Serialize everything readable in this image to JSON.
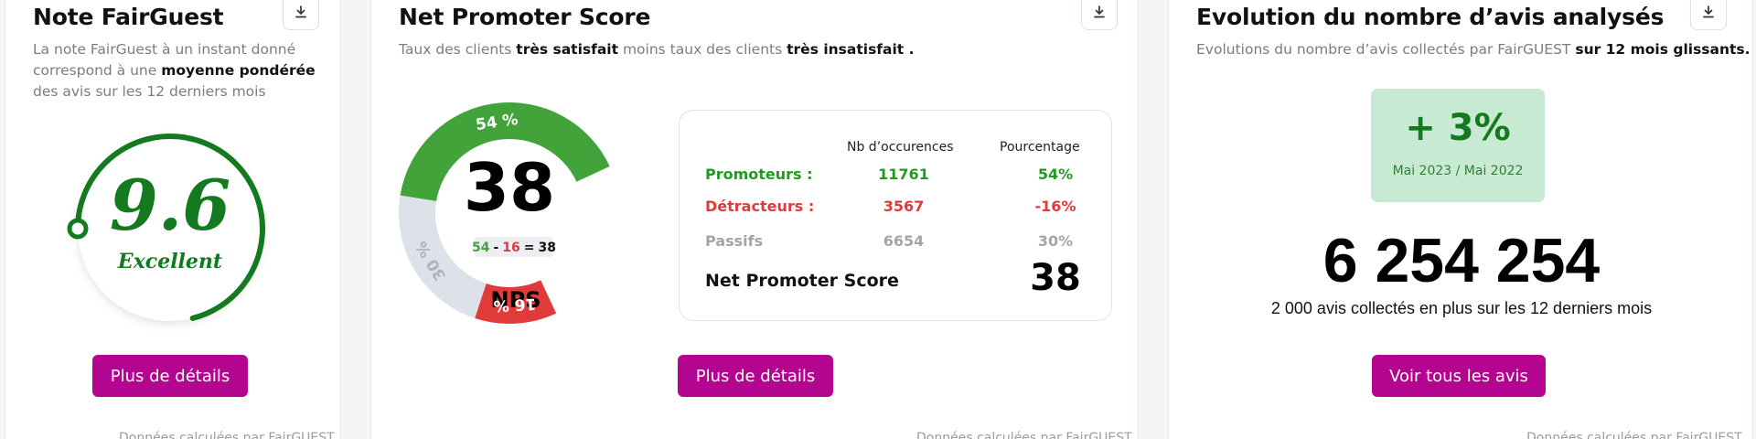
{
  "colors": {
    "brand": "#b3058f",
    "green": "#41a33a",
    "dark_green": "#137a1f",
    "red": "#e03a3a",
    "grey": "#a2a5aa",
    "light_grey": "#dde2ea"
  },
  "card1": {
    "title": "Note FairGuest",
    "desc_part1": "La note FairGuest à un instant donné correspond à une ",
    "desc_bold": "moyenne pondérée",
    "desc_part2": " des avis sur les 12 derniers mois",
    "score": "9.6",
    "score_label": "Excellent",
    "score_fraction": 0.96,
    "button": "Plus de détails",
    "footnote": "Données calculées par FairGUEST",
    "download_icon": "download-icon"
  },
  "card2": {
    "title": "Net Promoter Score",
    "desc_part1": "Taux des clients ",
    "desc_bold1": "très satisfait",
    "desc_part2": " moins taux des clients ",
    "desc_bold2": "très insatisfait .",
    "gauge": {
      "center_value": "38",
      "formula_a": "54",
      "formula_minus": "-",
      "formula_b": "16",
      "formula_eq": "=",
      "formula_result": "38",
      "label": "NPS",
      "segments": [
        {
          "name": "promoteurs",
          "percent": 54,
          "label": "54 %"
        },
        {
          "name": "detracteurs",
          "percent": 16,
          "label": "16 %"
        },
        {
          "name": "passifs",
          "percent": 30,
          "label": "30 %"
        }
      ]
    },
    "table": {
      "col_occurrences": "Nb d’occurences",
      "col_percent": "Pourcentage",
      "rows": [
        {
          "label": "Promoteurs :",
          "count": "11761",
          "percent": "54%"
        },
        {
          "label": "Détracteurs :",
          "count": "3567",
          "percent": "-16%"
        },
        {
          "label": "Passifs",
          "count": "6654",
          "percent": "30%"
        }
      ],
      "nps_label": "Net Promoter Score",
      "nps_value": "38"
    },
    "button": "Plus de détails",
    "footnote": "Données calculées par FairGUEST",
    "download_icon": "download-icon"
  },
  "card3": {
    "title": "Evolution du nombre d’avis analysés",
    "desc_part1": "Evolutions du nombre d’avis collectés par FairGUEST ",
    "desc_bold": "sur 12 mois glissants.",
    "badge_value": "+ 3%",
    "badge_period": "Mai 2023 / Mai 2022",
    "total": "6 254 254",
    "total_caption": "2 000 avis collectés en plus sur les 12 derniers mois",
    "button": "Voir tous les avis",
    "footnote": "Données calculées par FairGUEST",
    "download_icon": "download-icon"
  }
}
